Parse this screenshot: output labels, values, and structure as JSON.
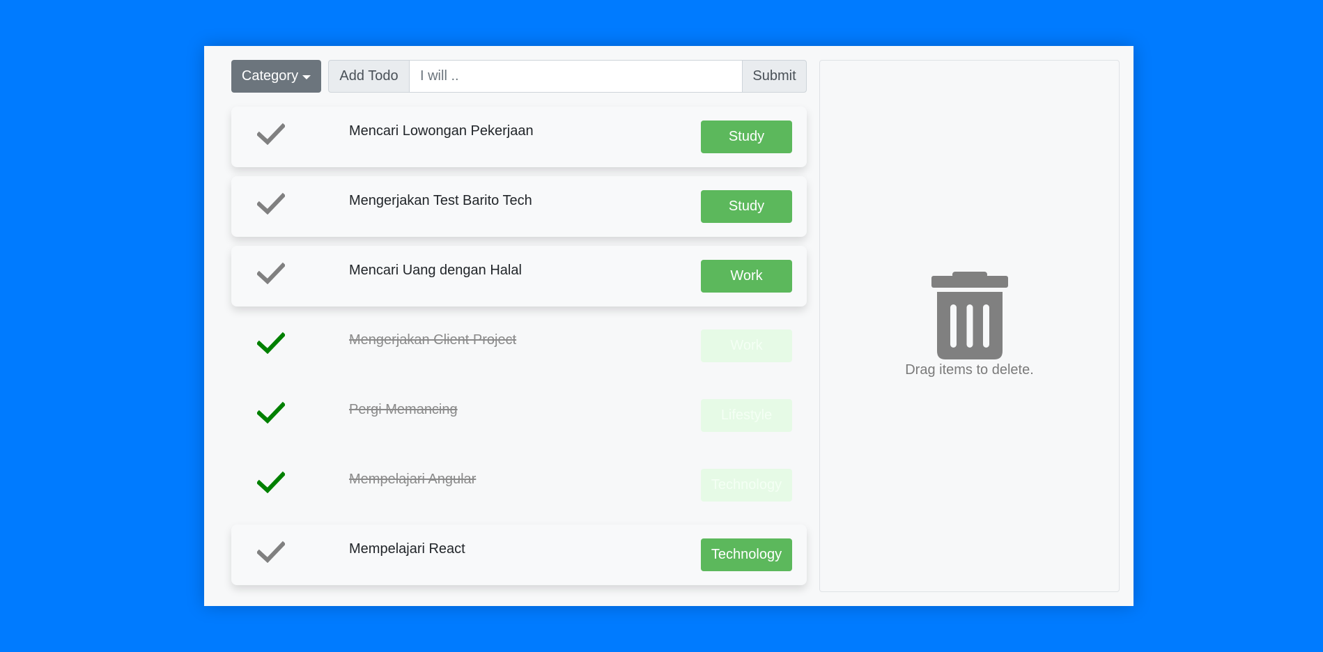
{
  "toolbar": {
    "category_label": "Category",
    "add_label": "Add Todo",
    "input_placeholder": "I will ..",
    "input_value": "",
    "submit_label": "Submit"
  },
  "todos": [
    {
      "title": "Mencari Lowongan Pekerjaan",
      "category": "Study",
      "done": false
    },
    {
      "title": "Mengerjakan Test Barito Tech",
      "category": "Study",
      "done": false
    },
    {
      "title": "Mencari Uang dengan Halal",
      "category": "Work",
      "done": false
    },
    {
      "title": "Mengerjakan Client Project",
      "category": "Work",
      "done": true
    },
    {
      "title": "Pergi Memancing",
      "category": "Lifestyle",
      "done": true
    },
    {
      "title": "Mempelajari Angular",
      "category": "Technology",
      "done": true
    },
    {
      "title": "Mempelajari React",
      "category": "Technology",
      "done": false
    }
  ],
  "trash": {
    "label": "Drag items to delete.",
    "icon": "trash-icon"
  },
  "colors": {
    "background": "#007bff",
    "badge": "#5cb85c",
    "check_done": "#008000",
    "check_pending": "#808080"
  }
}
